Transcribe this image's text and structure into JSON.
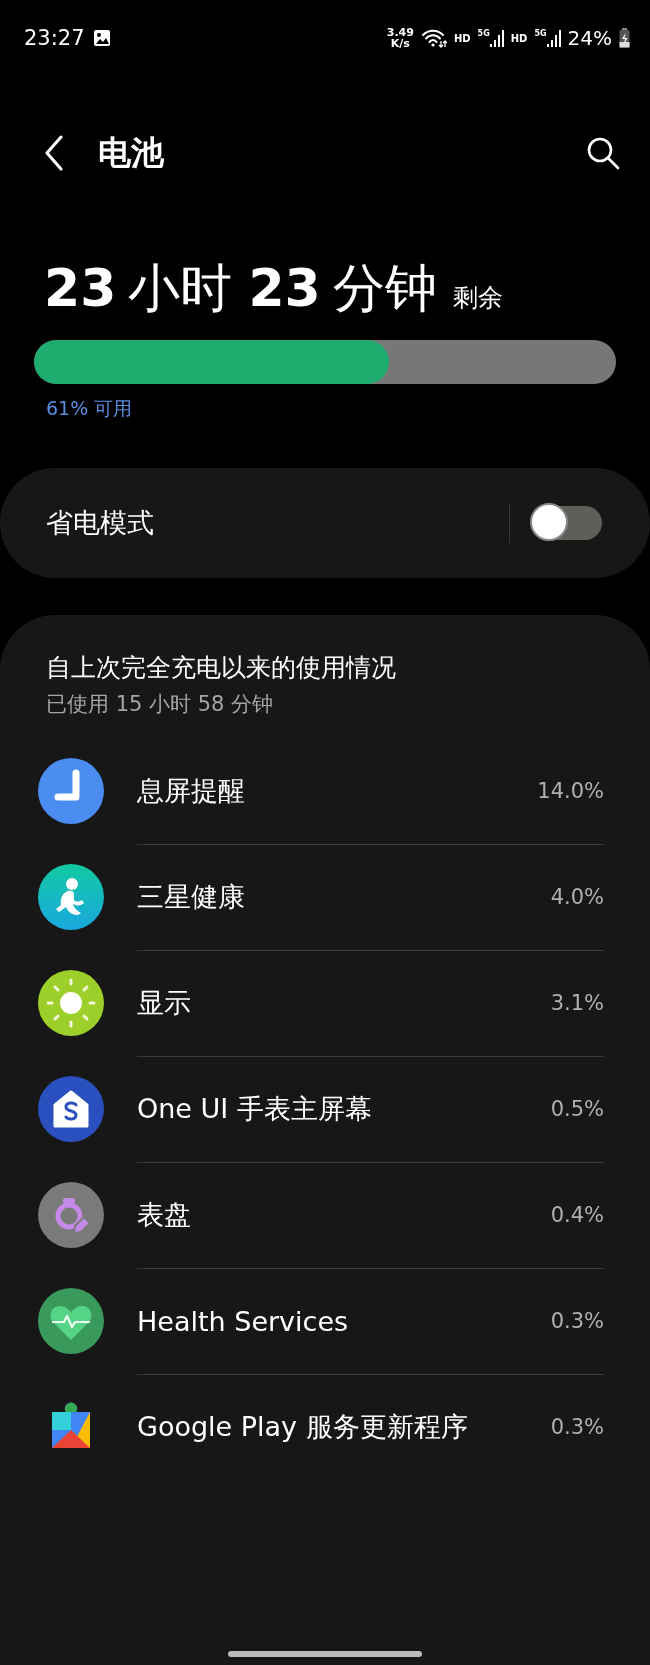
{
  "status_bar": {
    "time": "23:27",
    "speed_value": "3.49",
    "speed_unit": "K/s",
    "sims": [
      {
        "hd": "HD",
        "network": "5G"
      },
      {
        "hd": "HD",
        "network": "5G"
      }
    ],
    "battery": "24%"
  },
  "header": {
    "title": "电池"
  },
  "remaining": {
    "hours": "23",
    "hours_unit": "小时",
    "minutes": "23",
    "minutes_unit": "分钟",
    "suffix": "剩余"
  },
  "battery_bar": {
    "level": 0.61,
    "reading": "61% 可用"
  },
  "power_saving": {
    "label": "省电模式",
    "on": false
  },
  "usage": {
    "title": "自上次完全充电以来的使用情况",
    "subtitle": "已使用 15 小时 58 分钟",
    "apps": [
      {
        "kind": "clock",
        "name": "息屏提醒",
        "percent": "14.0%"
      },
      {
        "kind": "fitness",
        "name": "三星健康",
        "percent": "4.0%"
      },
      {
        "kind": "display",
        "name": "显示",
        "percent": "3.1%"
      },
      {
        "kind": "home",
        "name": "One UI 手表主屏幕",
        "percent": "0.5%"
      },
      {
        "kind": "watchface",
        "name": "表盘",
        "percent": "0.4%"
      },
      {
        "kind": "heart",
        "name": "Health Services",
        "percent": "0.3%"
      },
      {
        "kind": "puzzle",
        "name": "Google Play 服务更新程序",
        "percent": "0.3%"
      }
    ]
  }
}
